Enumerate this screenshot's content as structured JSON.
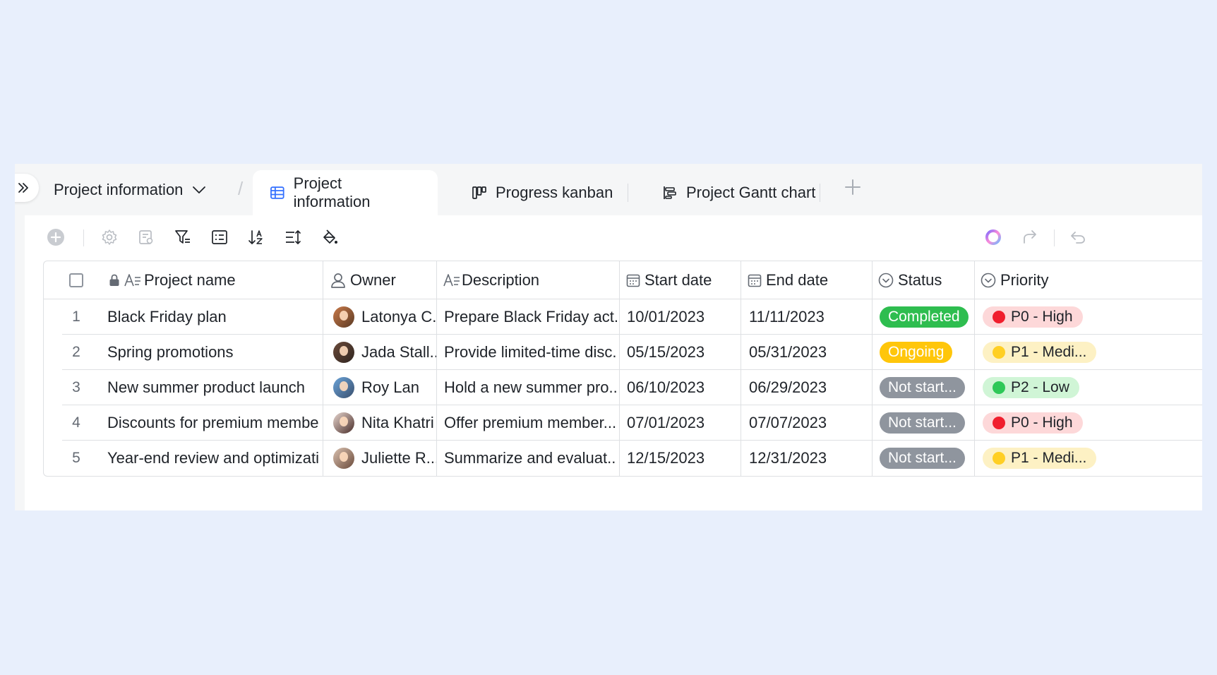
{
  "breadcrumb": {
    "label": "Project information"
  },
  "tabs": [
    {
      "label": "Project information",
      "icon": "grid-table-icon",
      "active": true
    },
    {
      "label": "Progress kanban",
      "icon": "kanban-icon",
      "active": false
    },
    {
      "label": "Project Gantt chart",
      "icon": "gantt-icon",
      "active": false
    }
  ],
  "toolbar": {
    "icons": [
      "add-record-icon",
      "settings-icon",
      "form-icon",
      "filter-icon",
      "group-icon",
      "sort-icon",
      "row-height-icon",
      "fill-color-icon"
    ],
    "right_icons": [
      "ai-assistant-icon",
      "share-icon",
      "undo-icon"
    ]
  },
  "table": {
    "columns": [
      {
        "label": "Project name",
        "icon": "text-field-icon",
        "locked": true
      },
      {
        "label": "Owner",
        "icon": "person-icon"
      },
      {
        "label": "Description",
        "icon": "text-field-icon"
      },
      {
        "label": "Start date",
        "icon": "calendar-icon"
      },
      {
        "label": "End date",
        "icon": "calendar-icon"
      },
      {
        "label": "Status",
        "icon": "single-select-icon"
      },
      {
        "label": "Priority",
        "icon": "single-select-icon"
      }
    ],
    "rows": [
      {
        "num": "1",
        "name": "Black Friday plan",
        "owner": "Latonya C...",
        "description": "Prepare Black Friday act...",
        "start": "10/01/2023",
        "end": "11/11/2023",
        "status": "Completed",
        "priority": "P0 - High"
      },
      {
        "num": "2",
        "name": "Spring promotions",
        "owner": "Jada Stall...",
        "description": "Provide limited-time disc...",
        "start": "05/15/2023",
        "end": "05/31/2023",
        "status": "Ongoing",
        "priority": "P1 - Medi..."
      },
      {
        "num": "3",
        "name": "New summer product launch",
        "owner": "Roy Lan",
        "description": "Hold a new summer pro...",
        "start": "06/10/2023",
        "end": "06/29/2023",
        "status": "Not start...",
        "priority": "P2 - Low"
      },
      {
        "num": "4",
        "name": "Discounts for premium members",
        "owner": "Nita Khatri",
        "description": "Offer premium member...",
        "start": "07/01/2023",
        "end": "07/07/2023",
        "status": "Not start...",
        "priority": "P0 - High"
      },
      {
        "num": "5",
        "name": "Year-end review and optimizati...",
        "owner": "Juliette R...",
        "description": "Summarize and evaluat...",
        "start": "12/15/2023",
        "end": "12/31/2023",
        "status": "Not start...",
        "priority": "P1 - Medi..."
      }
    ]
  },
  "colors": {
    "background": "#e8effc",
    "status_completed": "#2ebd4f",
    "status_ongoing": "#ffc60a",
    "status_not_started": "#8f959e",
    "priority_high_bg": "#fdd8d9",
    "priority_high_dot": "#f01e2d",
    "priority_medium_bg": "#fdf1c4",
    "priority_medium_dot": "#ffcf24",
    "priority_low_bg": "#d0f5d6",
    "priority_low_dot": "#2ec858"
  }
}
